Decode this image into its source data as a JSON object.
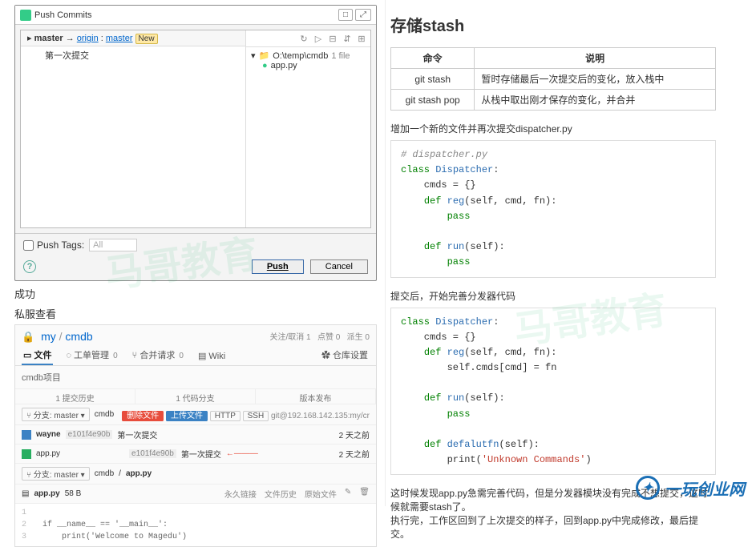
{
  "dialog": {
    "title": "Push Commits",
    "branch_from": "master",
    "arrow": "→",
    "remote": "origin",
    "target": "master",
    "tag": "New",
    "commit": "第一次提交",
    "tree_path": "O:\\temp\\cmdb",
    "tree_count": "1 file",
    "tree_file": "app.py",
    "push_tags_label": "Push Tags:",
    "push_tags_value": "All",
    "btn_push": "Push",
    "btn_cancel": "Cancel"
  },
  "captions": {
    "success": "成功",
    "private_view": "私服查看"
  },
  "repo": {
    "owner": "my",
    "name": "cmdb",
    "stats": {
      "watch": "关注/取消  1",
      "star": "点赞  0",
      "fork": "派生  0"
    },
    "tabs": {
      "files": "文件",
      "issues": "工单管理",
      "issues_badge": "0",
      "pr": "合并请求",
      "pr_badge": "0",
      "wiki": "Wiki",
      "settings": "仓库设置"
    },
    "desc": "cmdb项目",
    "subtabs": {
      "commits": "1 提交历史",
      "branches": "1 代码分支",
      "releases": "版本发布"
    },
    "bar": {
      "branch": "分支: master",
      "crumb": "cmdb",
      "del": "删除文件",
      "upload": "上传文件",
      "proto": "HTTP",
      "ssh": "SSH",
      "url": "git@192.168.142.135:my/cr"
    },
    "commit": {
      "user": "wayne",
      "hash1": "e101f4e90b",
      "msg": "第一次提交",
      "time": "2 天之前",
      "file": "app.py",
      "hash2": "e101f4e90b",
      "msg2": "第一次提交"
    },
    "bar2": {
      "branch": "分支: master",
      "crumb1": "cmdb",
      "crumb2": "app.py"
    },
    "filehdr": {
      "name": "app.py",
      "size": "58 B",
      "a1": "永久链接",
      "a2": "文件历史",
      "a3": "原始文件",
      "a4": "✎",
      "a5": "🗑"
    },
    "code_l1": "if __name__ == '__main__':",
    "code_l2": "    print('Welcome to Magedu')"
  },
  "right": {
    "h2": "存储stash",
    "table": {
      "h1": "命令",
      "h2": "说明",
      "r1c1": "git stash",
      "r1c2": "暂时存储最后一次提交后的变化，放入栈中",
      "r2c1": "git stash pop",
      "r2c2": "从栈中取出刚才保存的变化，并合并"
    },
    "p1": "增加一个新的文件并再次提交dispatcher.py",
    "p2": "提交后，开始完善分发器代码",
    "p3a": "这时候发现app.py急需完善代码，但是分发器模块没有完成不想提交，这时候就需要stash了。",
    "p3b": "执行完，工作区回到了上次提交的样子，回到app.py中完成修改，最后提交。"
  },
  "chart_data": {
    "type": "table",
    "columns": [
      "命令",
      "说明"
    ],
    "rows": [
      [
        "git stash",
        "暂时存储最后一次提交后的变化，放入栈中"
      ],
      [
        "git stash pop",
        "从栈中取出刚才保存的变化，并合并"
      ]
    ]
  },
  "brand": "一玩创业网",
  "wm": "马哥教育"
}
